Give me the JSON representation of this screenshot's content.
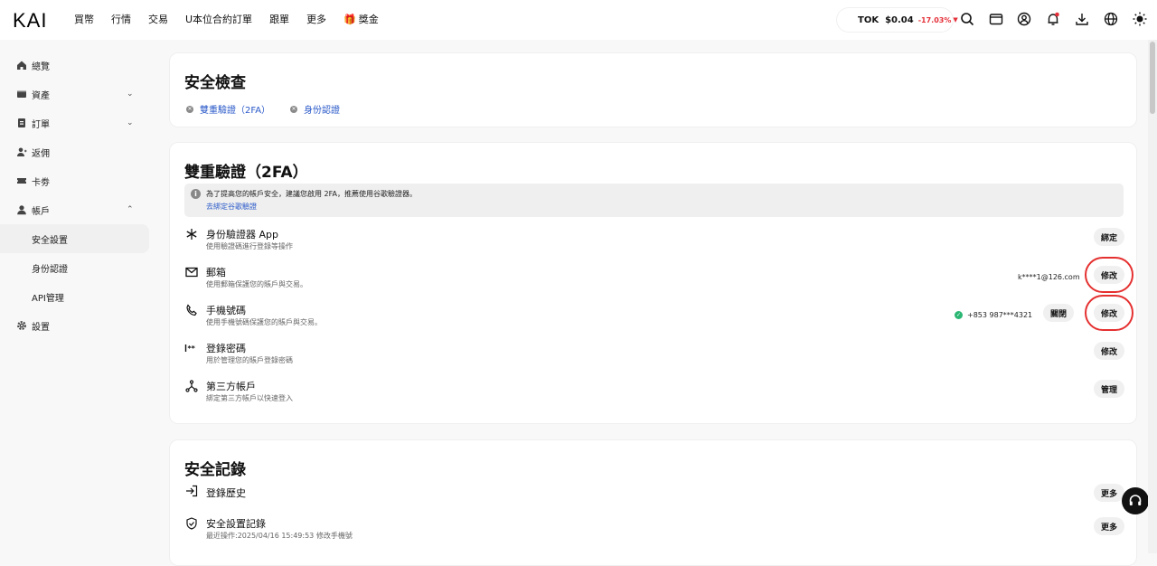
{
  "header": {
    "logo": "KAI",
    "nav": [
      {
        "label": "買幣"
      },
      {
        "label": "行情"
      },
      {
        "label": "交易"
      },
      {
        "label": "U本位合約訂單"
      },
      {
        "label": "跟單"
      },
      {
        "label": "更多"
      },
      {
        "label": "獎金",
        "icon": "gift-icon"
      }
    ],
    "ticker": {
      "symbol": "TOK",
      "price": "$0.04",
      "change": "-17.03%",
      "change_color": "#e5303a"
    },
    "icons": [
      "search-icon",
      "wallet-icon",
      "user-icon",
      "bell-icon",
      "download-icon",
      "globe-icon",
      "sun-icon"
    ]
  },
  "sidebar": {
    "items": [
      {
        "label": "總覽",
        "icon": "home-icon"
      },
      {
        "label": "資產",
        "icon": "wallet-icon",
        "caret": "⌄"
      },
      {
        "label": "訂單",
        "icon": "order-icon",
        "caret": "⌄"
      },
      {
        "label": "返佣",
        "icon": "referral-icon"
      },
      {
        "label": "卡劵",
        "icon": "ticket-icon"
      },
      {
        "label": "帳戶",
        "icon": "account-icon",
        "caret": "⌃"
      },
      {
        "label": "安全設置",
        "sub": true,
        "active": true
      },
      {
        "label": "身份認證",
        "sub": true
      },
      {
        "label": "API管理",
        "sub": true
      },
      {
        "label": "設置",
        "icon": "gear-icon"
      }
    ]
  },
  "security_check": {
    "title": "安全檢查",
    "items": [
      {
        "label": "雙重驗證（2FA）"
      },
      {
        "label": "身份認證"
      }
    ]
  },
  "twofa": {
    "title": "雙重驗證（2FA）",
    "notice": {
      "text": "為了提高您的帳戶安全，建議您啟用 2FA，推薦使用谷歌驗證器。",
      "link": "去綁定谷歌驗證"
    },
    "rows": [
      {
        "title": "身份驗證器 App",
        "desc": "使用驗證碼進行登錄等操作",
        "icon": "authenticator-icon",
        "value": "",
        "actions": [
          "綁定"
        ]
      },
      {
        "title": "郵箱",
        "desc": "使用郵箱保護您的賬戶與交易。",
        "icon": "mail-icon",
        "value": "k****1@126.com",
        "actions": [
          "修改"
        ]
      },
      {
        "title": "手機號碼",
        "desc": "使用手機號碼保護您的賬戶與交易。",
        "icon": "phone-icon",
        "value": "+853 987***4321",
        "verified": true,
        "actions": [
          "關閉",
          "修改"
        ]
      },
      {
        "title": "登錄密碼",
        "desc": "用於管理您的賬戶登錄密碼",
        "icon": "password-icon",
        "value": "",
        "actions": [
          "修改"
        ]
      },
      {
        "title": "第三方帳戶",
        "desc": "綁定第三方帳戶以快速登入",
        "icon": "third-party-icon",
        "value": "",
        "actions": [
          "管理"
        ]
      }
    ]
  },
  "records": {
    "title": "安全記錄",
    "rows": [
      {
        "title": "登錄歷史",
        "desc": "",
        "icon": "login-icon",
        "action": "更多"
      },
      {
        "title": "安全設置記錄",
        "desc": "最近操作:2025/04/16 15:49:53 修改手機號",
        "icon": "shield-icon",
        "action": "更多"
      }
    ]
  }
}
